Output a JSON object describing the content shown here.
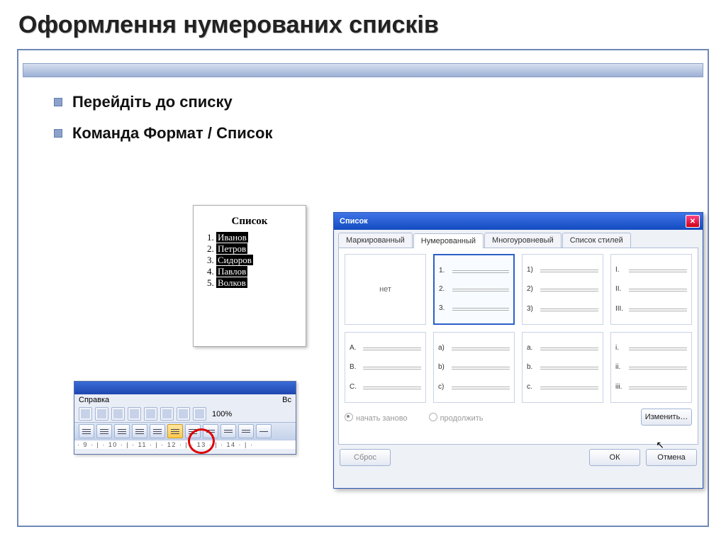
{
  "title": "Оформлення нумерованих списків",
  "bullets": [
    "Перейдіть до списку",
    "Команда Формат / Список"
  ],
  "doc_preview": {
    "heading": "Список",
    "items": [
      "Иванов",
      "Петров",
      "Сидоров",
      "Павлов",
      "Волков"
    ]
  },
  "snippet": {
    "menu_left": "Справка",
    "menu_right": "Вс",
    "zoom": "100%",
    "ruler": "· 9 · | · 10 · | · 11 · | · 12 · | · 13 · | · 14 · | ·"
  },
  "dialog": {
    "title": "Список",
    "tabs": [
      "Маркированный",
      "Нумерованный",
      "Многоуровневый",
      "Список стилей"
    ],
    "active_tab_index": 1,
    "none_label": "нет",
    "options": [
      [
        "1.",
        "2.",
        "3."
      ],
      [
        "1)",
        "2)",
        "3)"
      ],
      [
        "I.",
        "II.",
        "III."
      ],
      [
        "A.",
        "B.",
        "C."
      ],
      [
        "a)",
        "b)",
        "c)"
      ],
      [
        "a.",
        "b.",
        "c."
      ],
      [
        "i.",
        "ii.",
        "iii."
      ]
    ],
    "radio_restart": "начать заново",
    "radio_continue": "продолжить",
    "btn_change": "Изменить…",
    "btn_reset": "Сброс",
    "btn_ok": "ОК",
    "btn_cancel": "Отмена"
  }
}
